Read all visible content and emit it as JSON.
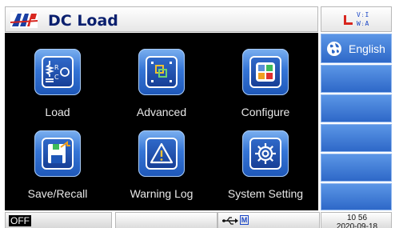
{
  "header": {
    "title": "DC Load",
    "status_via": [
      "V",
      "I",
      "A"
    ],
    "status_w": "W"
  },
  "apps": [
    {
      "label": "Load",
      "icon": "load-resistor-icon"
    },
    {
      "label": "Advanced",
      "icon": "advanced-icon"
    },
    {
      "label": "Configure",
      "icon": "configure-icon"
    },
    {
      "label": "Save/Recall",
      "icon": "save-recall-icon"
    },
    {
      "label": "Warning Log",
      "icon": "warning-icon"
    },
    {
      "label": "System Setting",
      "icon": "gear-icon"
    }
  ],
  "sidebar": {
    "language_label": "English",
    "language_icon": "globe-icon",
    "blank_buttons": 5
  },
  "statusbar": {
    "output_state": "OFF",
    "mode_badge": "M",
    "usb_icon": "usb-icon",
    "time": "10 56",
    "date": "2020-09-18"
  },
  "colors": {
    "title_text": "#0a1f6e",
    "button_blue": "#2e68c8",
    "icon_blue": "#3575d6",
    "background": "#000000"
  }
}
